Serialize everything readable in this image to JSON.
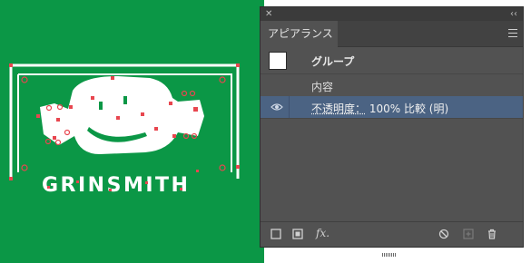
{
  "artwork": {
    "wordmark": "GRINSMITH",
    "background_color": "#0b9746",
    "anchor_color": "#e8464f"
  },
  "panel": {
    "close_icon": "close-icon",
    "collapse_icon": "double-chevron-icon",
    "tab_label": "アピアランス",
    "menu_icon": "hamburger-menu-icon",
    "rows": {
      "group_label": "グループ",
      "content_label": "内容",
      "opacity_name": "不透明度：",
      "opacity_value": "100% 比較 (明)"
    },
    "footer_icons": [
      "add-stroke-icon",
      "add-fill-icon",
      "fx-icon",
      "clear-appearance-icon",
      "duplicate-item-icon",
      "delete-icon"
    ],
    "fx_label": "fx."
  }
}
